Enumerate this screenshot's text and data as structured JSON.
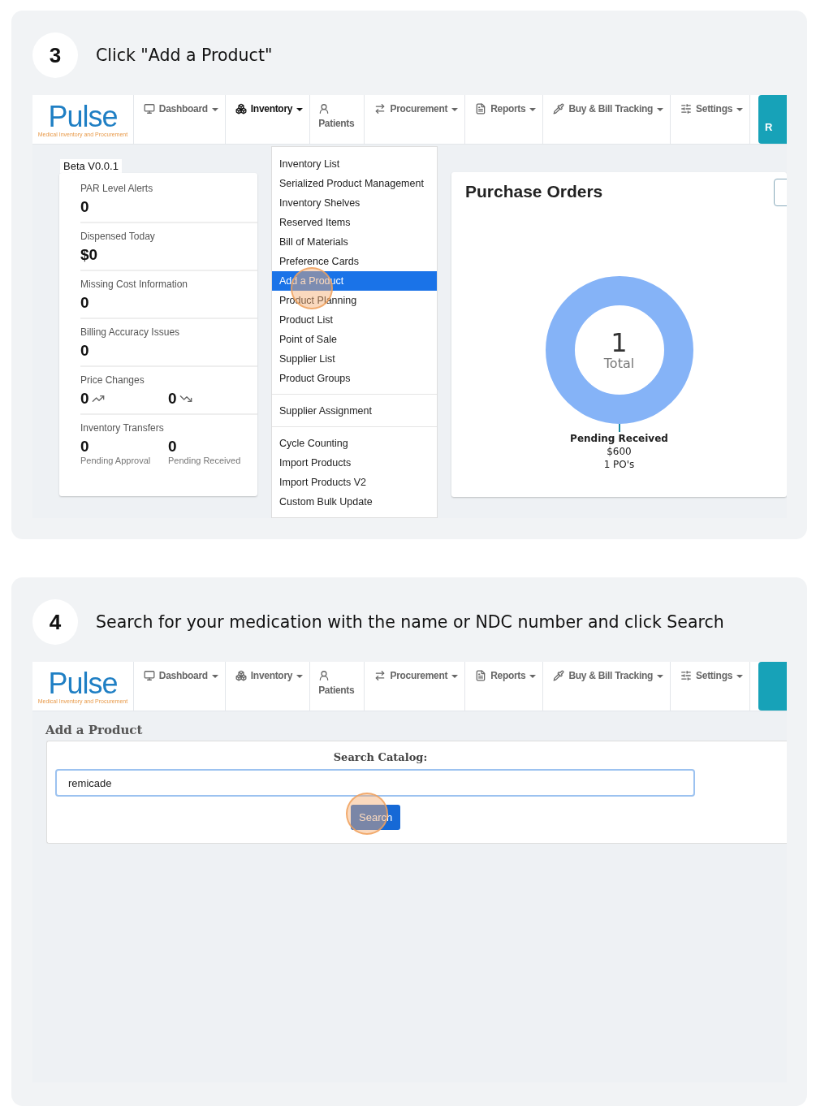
{
  "steps": [
    {
      "number": "3",
      "instruction": "Click \"Add a Product\"",
      "screen": {
        "kind": "dashboard",
        "nav": {
          "logo": "Pulse",
          "tagline": "Medical Inventory and Procurement",
          "edge_button": "R",
          "items": [
            {
              "kind": "monitor",
              "label": "Dashboard",
              "active": false
            },
            {
              "kind": "cubes",
              "label": "Inventory",
              "active": true
            },
            {
              "kind": "person",
              "label": "Patients",
              "active": false
            },
            {
              "kind": "arrows",
              "label": "Procurement",
              "active": false
            },
            {
              "kind": "document",
              "label": "Reports",
              "active": false
            },
            {
              "kind": "pipette",
              "label": "Buy & Bill Tracking",
              "active": false
            },
            {
              "kind": "sliders",
              "label": "Settings",
              "active": false
            }
          ]
        },
        "version": "Beta V0.0.1",
        "stats": [
          {
            "kind": "single",
            "label": "PAR Level Alerts",
            "value": "0"
          },
          {
            "kind": "single",
            "label": "Dispensed Today",
            "value": "$0"
          },
          {
            "kind": "single",
            "label": "Missing Cost Information",
            "value": "0"
          },
          {
            "kind": "single",
            "label": "Billing Accuracy Issues",
            "value": "0"
          },
          {
            "kind": "trend",
            "label": "Price Changes",
            "values": [
              {
                "kind": "up",
                "value": "0"
              },
              {
                "kind": "down",
                "value": "0"
              }
            ]
          },
          {
            "kind": "pair",
            "label": "Inventory Transfers",
            "values": [
              {
                "value": "0",
                "caption": "Pending Approval"
              },
              {
                "value": "0",
                "caption": "Pending Received"
              }
            ]
          }
        ],
        "menu_groups": [
          [
            {
              "label": "Inventory List",
              "selected": false
            },
            {
              "label": "Serialized Product Management",
              "selected": false
            },
            {
              "label": "Inventory Shelves",
              "selected": false
            },
            {
              "label": "Reserved Items",
              "selected": false
            },
            {
              "label": "Bill of Materials",
              "selected": false
            },
            {
              "label": "Preference Cards",
              "selected": false
            },
            {
              "label": "Add a Product",
              "selected": true
            },
            {
              "label": "Product Planning",
              "selected": false
            },
            {
              "label": "Product List",
              "selected": false
            },
            {
              "label": "Point of Sale",
              "selected": false
            },
            {
              "label": "Supplier List",
              "selected": false
            },
            {
              "label": "Product Groups",
              "selected": false
            }
          ],
          [
            {
              "label": "Supplier Assignment",
              "selected": false
            }
          ],
          [
            {
              "label": "Cycle Counting",
              "selected": false
            },
            {
              "label": "Import Products",
              "selected": false
            },
            {
              "label": "Import Products V2",
              "selected": false
            },
            {
              "label": "Custom Bulk Update",
              "selected": false
            }
          ]
        ],
        "purchase_orders": {
          "title": "Purchase Orders",
          "center_value": "1",
          "center_label": "Total",
          "slice_name": "Pending Received",
          "slice_amount": "$600",
          "slice_count": "1 PO's"
        }
      }
    },
    {
      "number": "4",
      "instruction": "Search for your medication with the name or NDC number and click Search",
      "screen": {
        "kind": "add_product",
        "nav": {
          "logo": "Pulse",
          "tagline": "Medical Inventory and Procurement",
          "items": [
            {
              "kind": "monitor",
              "label": "Dashboard",
              "active": false
            },
            {
              "kind": "cubes",
              "label": "Inventory",
              "active": false
            },
            {
              "kind": "person",
              "label": "Patients",
              "active": false
            },
            {
              "kind": "arrows",
              "label": "Procurement",
              "active": false
            },
            {
              "kind": "document",
              "label": "Reports",
              "active": false
            },
            {
              "kind": "pipette",
              "label": "Buy & Bill Tracking",
              "active": false
            },
            {
              "kind": "sliders",
              "label": "Settings",
              "active": false
            }
          ]
        },
        "heading": "Add a Product",
        "search_label": "Search Catalog:",
        "search_value": "remicade",
        "button": "Search"
      }
    }
  ]
}
